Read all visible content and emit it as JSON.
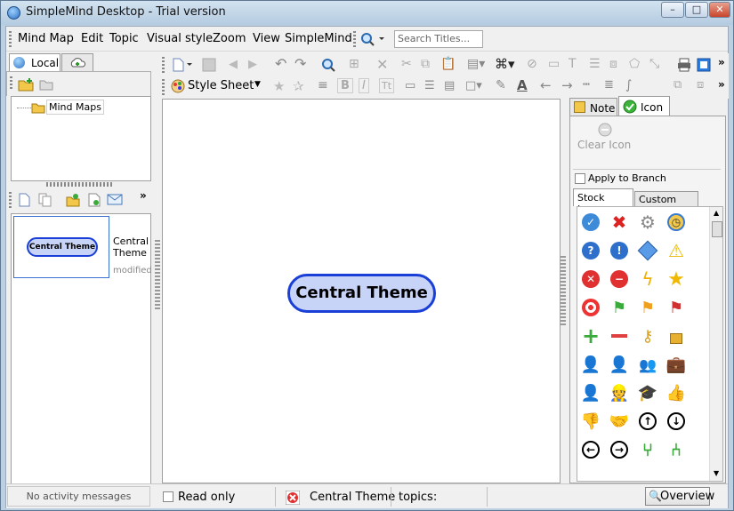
{
  "window": {
    "title": "SimpleMind Desktop - Trial version",
    "controls": [
      "–",
      "□",
      "✕"
    ]
  },
  "menu": {
    "items": [
      "Mind Map",
      "Edit",
      "Topic",
      "Visual style",
      "Zoom",
      "View",
      "SimpleMind"
    ],
    "search_placeholder": "Search Titles..."
  },
  "toolbar2": {
    "style_sheet_label": "Style Sheet"
  },
  "left": {
    "tabs": [
      "Local",
      ""
    ],
    "tree_root": "Mind Maps",
    "thumb_title": "Central Theme",
    "thumb_name_line1": "Central",
    "thumb_name_line2": "Theme",
    "thumb_status": "modified",
    "activity": "No activity messages"
  },
  "canvas": {
    "central_node": "Central Theme"
  },
  "right": {
    "tabs": [
      "Note",
      "Icon"
    ],
    "clear_icon": "Clear Icon",
    "apply_to_branch": "Apply to Branch",
    "icon_tabs": [
      "Stock Icons",
      "Custom Icons"
    ]
  },
  "status": {
    "read_only": "Read only",
    "current_topic": "Central Theme",
    "topics_label": "topics:",
    "overview": "Overview"
  },
  "colors": {
    "node_fill": "#c7d3f7",
    "node_border": "#1a3fd6",
    "accent": "#2f6db5"
  }
}
